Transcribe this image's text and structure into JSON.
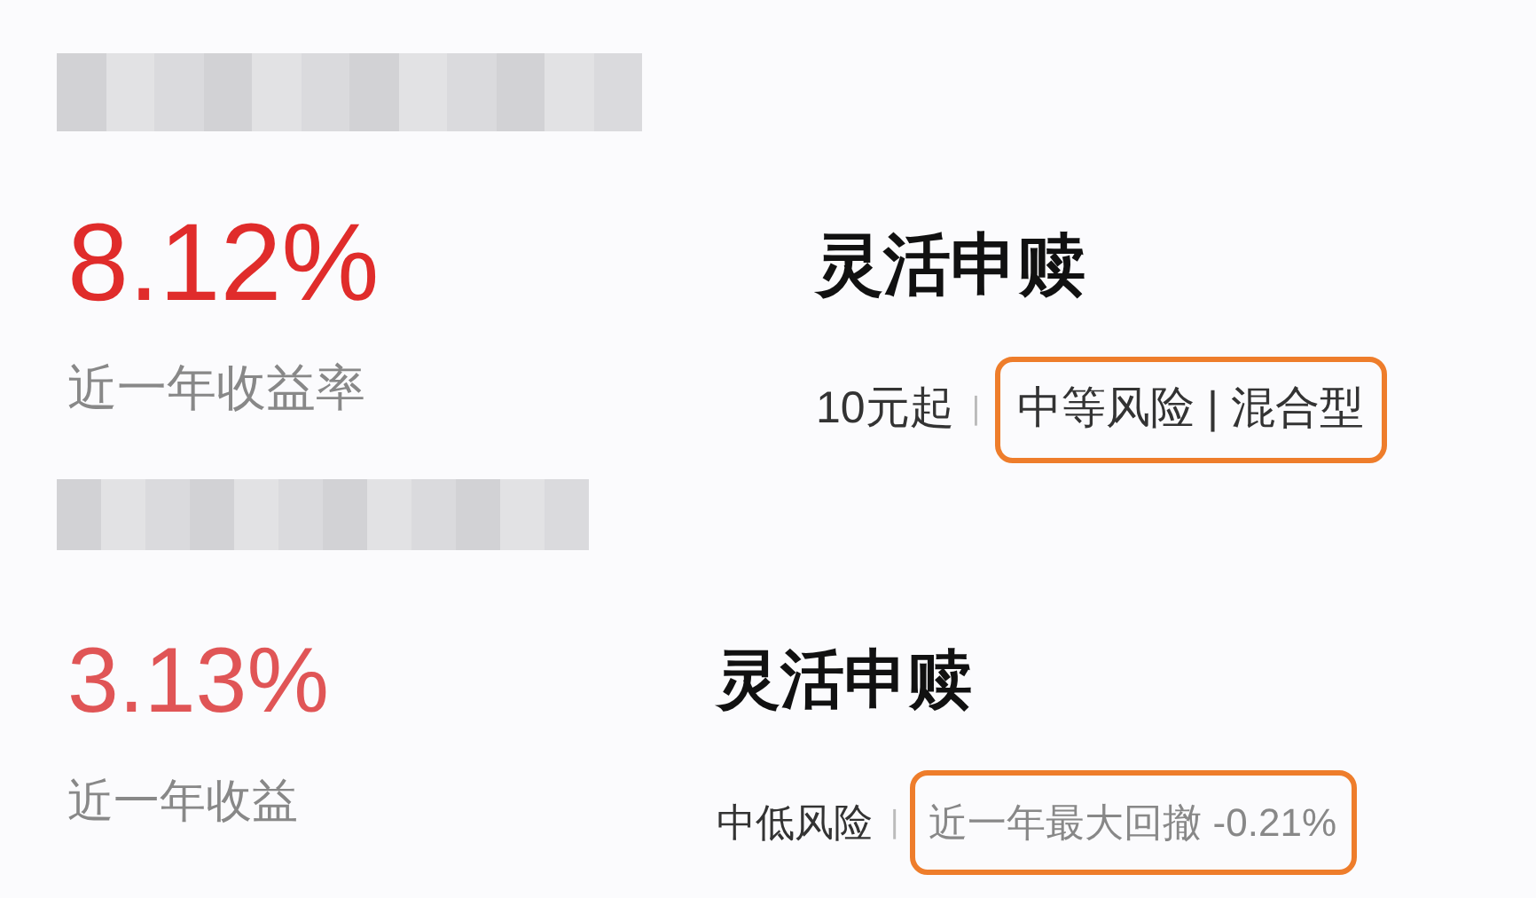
{
  "funds": [
    {
      "return": "8.12%",
      "return_label": "近一年收益率",
      "redemption": "灵活申赎",
      "detail_plain": "10元起",
      "separator": "|",
      "detail_highlighted": "中等风险 | 混合型"
    },
    {
      "return": "3.13%",
      "return_label": "近一年收益",
      "redemption": "灵活申赎",
      "detail_plain": "中低风险",
      "separator": "|",
      "detail_highlighted": "近一年最大回撤 -0.21%"
    }
  ]
}
